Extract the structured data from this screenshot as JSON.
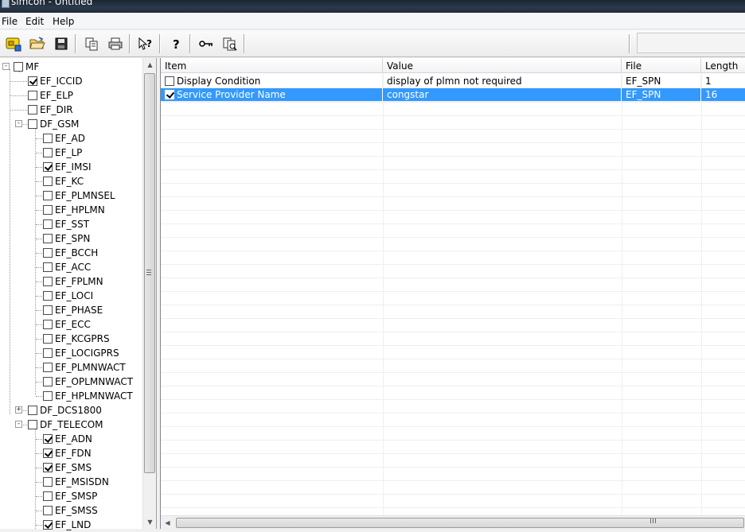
{
  "window": {
    "title": "simcon - Untitled"
  },
  "menu": {
    "items": [
      "File",
      "Edit",
      "Help"
    ]
  },
  "toolbar": {
    "buttons": [
      {
        "icon": "new-card-icon"
      },
      {
        "icon": "open-folder-icon"
      },
      {
        "icon": "save-disk-icon"
      },
      {
        "icon": "copy-icon"
      },
      {
        "icon": "print-icon"
      },
      {
        "icon": "context-help-icon"
      },
      {
        "icon": "help-icon"
      },
      {
        "icon": "key-icon"
      },
      {
        "icon": "compare-icon"
      }
    ]
  },
  "tree": {
    "nodes": [
      {
        "label": "MF",
        "checked": false,
        "expander": "-"
      },
      {
        "label": "EF_ICCID",
        "checked": true
      },
      {
        "label": "EF_ELP",
        "checked": false
      },
      {
        "label": "EF_DIR",
        "checked": false
      },
      {
        "label": "DF_GSM",
        "checked": false,
        "expander": "-"
      },
      {
        "label": "EF_AD",
        "checked": false
      },
      {
        "label": "EF_LP",
        "checked": false
      },
      {
        "label": "EF_IMSI",
        "checked": true
      },
      {
        "label": "EF_KC",
        "checked": false
      },
      {
        "label": "EF_PLMNSEL",
        "checked": false
      },
      {
        "label": "EF_HPLMN",
        "checked": false
      },
      {
        "label": "EF_SST",
        "checked": false
      },
      {
        "label": "EF_SPN",
        "checked": false
      },
      {
        "label": "EF_BCCH",
        "checked": false
      },
      {
        "label": "EF_ACC",
        "checked": false
      },
      {
        "label": "EF_FPLMN",
        "checked": false
      },
      {
        "label": "EF_LOCI",
        "checked": false
      },
      {
        "label": "EF_PHASE",
        "checked": false
      },
      {
        "label": "EF_ECC",
        "checked": false
      },
      {
        "label": "EF_KCGPRS",
        "checked": false
      },
      {
        "label": "EF_LOCIGPRS",
        "checked": false
      },
      {
        "label": "EF_PLMNWACT",
        "checked": false
      },
      {
        "label": "EF_OPLMNWACT",
        "checked": false
      },
      {
        "label": "EF_HPLMNWACT",
        "checked": false
      },
      {
        "label": "DF_DCS1800",
        "checked": false,
        "expander": "+"
      },
      {
        "label": "DF_TELECOM",
        "checked": false,
        "expander": "-"
      },
      {
        "label": "EF_ADN",
        "checked": true
      },
      {
        "label": "EF_FDN",
        "checked": true
      },
      {
        "label": "EF_SMS",
        "checked": true
      },
      {
        "label": "EF_MSISDN",
        "checked": false
      },
      {
        "label": "EF_SMSP",
        "checked": false
      },
      {
        "label": "EF_SMSS",
        "checked": false
      },
      {
        "label": "EF_LND",
        "checked": true
      }
    ]
  },
  "list": {
    "columns": [
      "Item",
      "Value",
      "File",
      "Length"
    ],
    "rows": [
      {
        "item": "Display Condition",
        "value": "display of plmn not required",
        "file": "EF_SPN",
        "length": "1",
        "checked": false,
        "selected": false
      },
      {
        "item": "Service Provider Name",
        "value": "congstar",
        "file": "EF_SPN",
        "length": "16",
        "checked": true,
        "selected": true
      }
    ]
  },
  "colors": {
    "selection": "#3399ff",
    "titlebar": "#1f2a37"
  }
}
